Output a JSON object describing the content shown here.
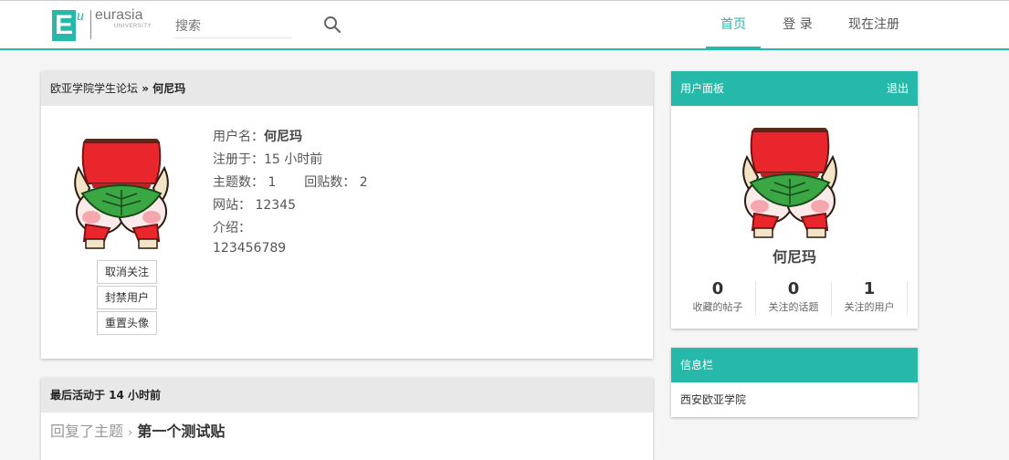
{
  "header": {
    "logo_letter": "E",
    "logo_u": "u",
    "logo_text": "eurasia",
    "logo_sub": "UNIVERSITY",
    "search_placeholder": "搜索",
    "nav": {
      "home": "首页",
      "login": "登 录",
      "register": "现在注册"
    }
  },
  "breadcrumb": {
    "forum": "欧亚学院学生论坛",
    "sep": " » ",
    "user": "何尼玛"
  },
  "profile": {
    "username_label": "用户名：",
    "username": "何尼玛",
    "registered": "注册于：15 小时前",
    "topics_label": "主题数：",
    "topics": "1",
    "replies_label": "回贴数：",
    "replies": "2",
    "website_label": "网站：",
    "website": "12345",
    "intro_label": "介绍：",
    "intro": "123456789",
    "buttons": {
      "unfollow": "取消关注",
      "ban": "封禁用户",
      "reset_avatar": "重置头像"
    }
  },
  "activity": {
    "header": "最后活动于 14 小时前",
    "action": "回复了主题",
    "arrow": "›",
    "topic": "第一个测试贴"
  },
  "user_panel": {
    "title": "用户面板",
    "logout": "退出",
    "name": "何尼玛",
    "stats": [
      {
        "value": "0",
        "label": "收藏的帖子"
      },
      {
        "value": "0",
        "label": "关注的话题"
      },
      {
        "value": "1",
        "label": "关注的用户"
      }
    ]
  },
  "info_bar": {
    "title": "信息栏",
    "content": "西安欧亚学院"
  },
  "colors": {
    "accent": "#26b9a9",
    "avatar_red": "#e8262b",
    "avatar_green": "#3aa644"
  },
  "icons": {
    "search": "search-icon",
    "avatar": "avatar-image"
  }
}
